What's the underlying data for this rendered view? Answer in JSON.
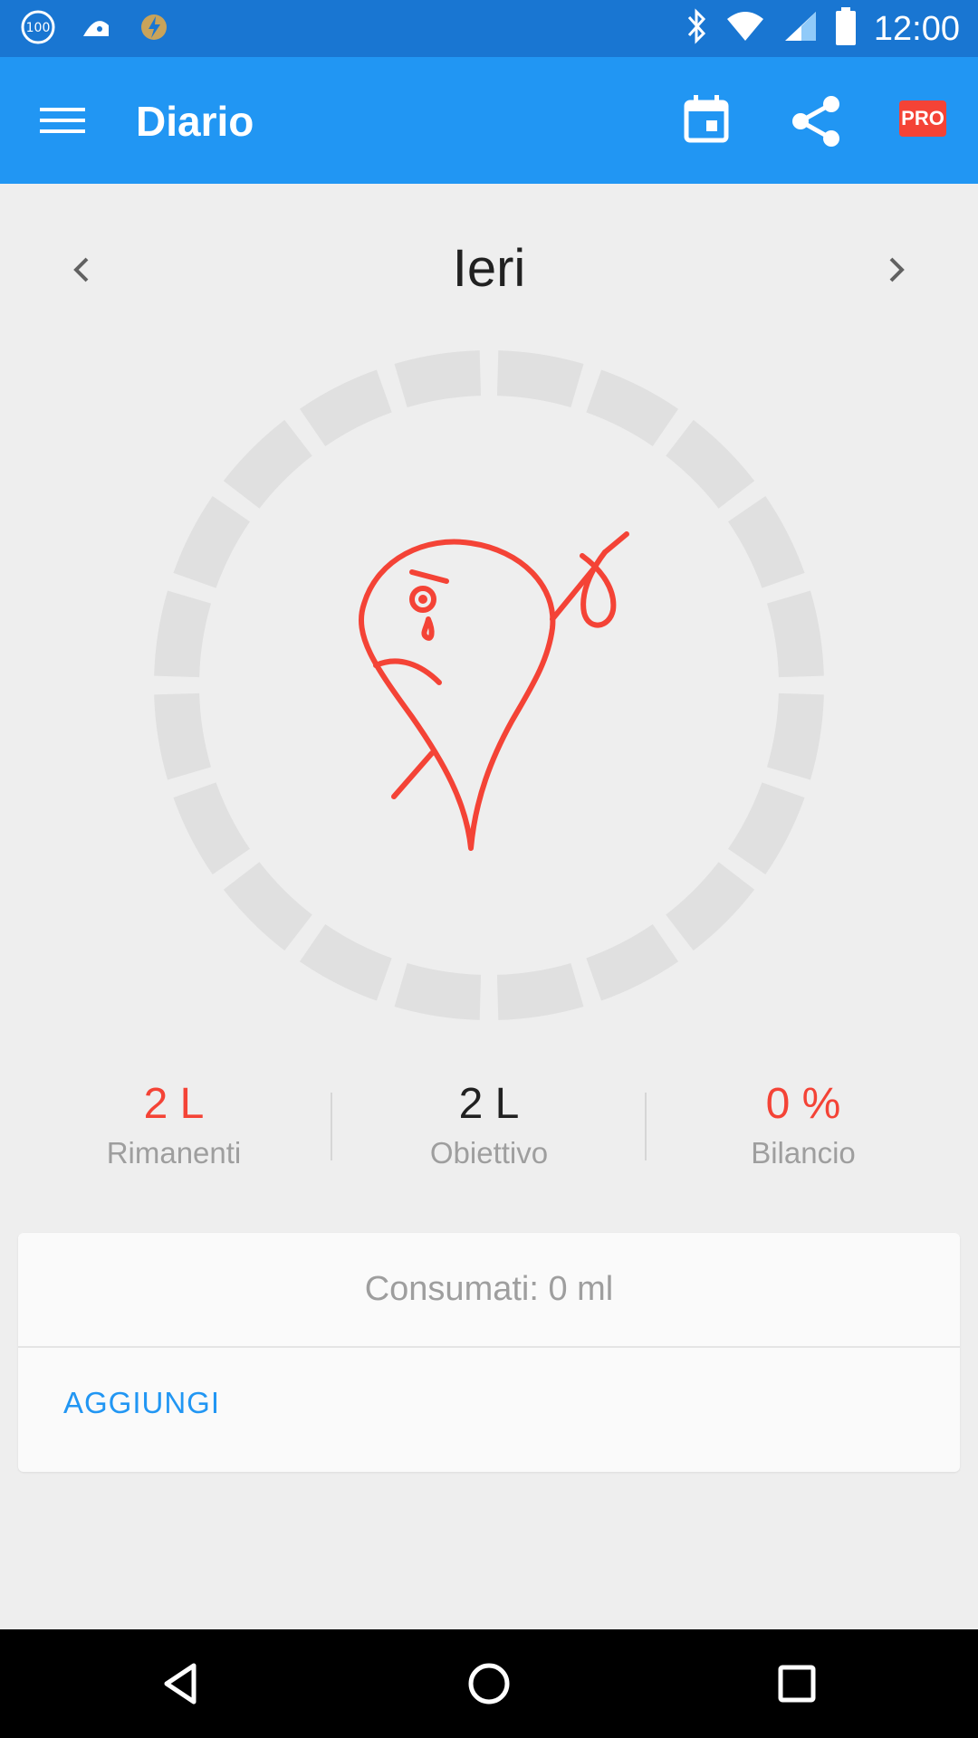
{
  "status_bar": {
    "time": "12:00",
    "left_icons": [
      "battery-100-icon",
      "android-debug-icon",
      "tasker-icon"
    ],
    "right_icons": [
      "bluetooth-icon",
      "wifi-icon",
      "signal-icon",
      "battery-icon"
    ]
  },
  "app_bar": {
    "title": "Diario",
    "pro_label": "PRO",
    "icons": [
      "menu-icon",
      "calendar-icon",
      "share-icon",
      "pro-badge"
    ]
  },
  "day_nav": {
    "label": "Ieri"
  },
  "progress": {
    "segments": 20,
    "filled": 0,
    "mood": "sad-drop"
  },
  "stats": [
    {
      "value": "2 L",
      "label": "Rimanenti",
      "color": "#f44336"
    },
    {
      "value": "2 L",
      "label": "Obiettivo",
      "color": "#212121"
    },
    {
      "value": "0 %",
      "label": "Bilancio",
      "color": "#f44336"
    }
  ],
  "card": {
    "consumed": "Consumati: 0 ml",
    "action": "AGGIUNGI"
  },
  "colors": {
    "primary": "#2196f3",
    "primary_dark": "#1976d2",
    "accent_red": "#f44336",
    "ring": "#e0e0e0"
  }
}
